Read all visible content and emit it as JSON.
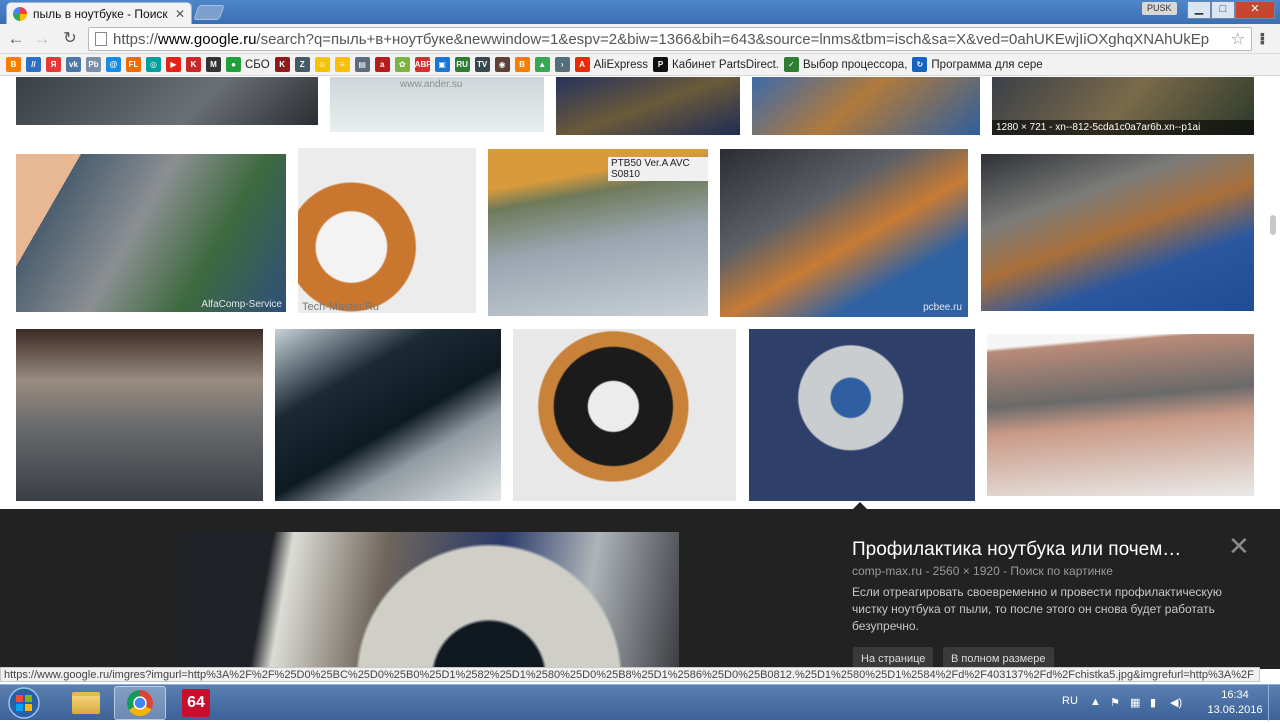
{
  "browser": {
    "tab_title": "пыль в ноутбуке - Поиск",
    "user_badge": "PUSK",
    "url_prefix": "https://",
    "url_host": "www.google.ru",
    "url_rest": "/search?q=пыль+в+ноутбуке&newwindow=1&espv=2&biw=1366&bih=643&source=lnms&tbm=isch&sa=X&ved=0ahUKEwjIiOXghqXNAhUkEp"
  },
  "bookmarks": [
    {
      "label": "",
      "icon": "blogger-icon",
      "color": "#f57d00",
      "glyph": "B"
    },
    {
      "label": "",
      "icon": "stripes-icon",
      "color": "#2d6fc2",
      "glyph": "//"
    },
    {
      "label": "",
      "icon": "yandex-icon",
      "color": "#e53935",
      "glyph": "Я"
    },
    {
      "label": "",
      "icon": "vk-icon",
      "color": "#4a76a8",
      "glyph": "vk"
    },
    {
      "label": "",
      "icon": "rb-icon",
      "color": "#7b8ea8",
      "glyph": "Pb"
    },
    {
      "label": "",
      "icon": "mail-icon",
      "color": "#168de2",
      "glyph": "@"
    },
    {
      "label": "",
      "icon": "fl-icon",
      "color": "#ef6c00",
      "glyph": "FL"
    },
    {
      "label": "",
      "icon": "circle-icon",
      "color": "#00a0a0",
      "glyph": "◎"
    },
    {
      "label": "",
      "icon": "youtube-icon",
      "color": "#e62117",
      "glyph": "▶"
    },
    {
      "label": "",
      "icon": "k-icon",
      "color": "#c62828",
      "glyph": "K"
    },
    {
      "label": "",
      "icon": "m-icon",
      "color": "#333333",
      "glyph": "M"
    },
    {
      "label": "СБО",
      "icon": "sberbank-icon",
      "color": "#21a038",
      "glyph": "●"
    },
    {
      "label": "",
      "icon": "kinopoisk-icon",
      "color": "#8e1b1b",
      "glyph": "K"
    },
    {
      "label": "",
      "icon": "z-icon",
      "color": "#455a64",
      "glyph": "Z"
    },
    {
      "label": "",
      "icon": "smiley-icon",
      "color": "#f5c400",
      "glyph": "☺"
    },
    {
      "label": "",
      "icon": "beeline-icon",
      "color": "#f9c100",
      "glyph": "≡"
    },
    {
      "label": "",
      "icon": "stack-icon",
      "color": "#5d6d7e",
      "glyph": "▤"
    },
    {
      "label": "",
      "icon": "abc-icon",
      "color": "#b71c1c",
      "glyph": "a"
    },
    {
      "label": "",
      "icon": "flower-icon",
      "color": "#7cb342",
      "glyph": "✿"
    },
    {
      "label": "",
      "icon": "adblock-icon",
      "color": "#d32f2f",
      "glyph": "ABP"
    },
    {
      "label": "",
      "icon": "window-icon",
      "color": "#1976d2",
      "glyph": "▣"
    },
    {
      "label": "",
      "icon": "ru-icon",
      "color": "#2e7d32",
      "glyph": "RU"
    },
    {
      "label": "",
      "icon": "tv-icon",
      "color": "#37474f",
      "glyph": "TV"
    },
    {
      "label": "",
      "icon": "lamp-icon",
      "color": "#5d4037",
      "glyph": "◉"
    },
    {
      "label": "",
      "icon": "blogger2-icon",
      "color": "#f57d00",
      "glyph": "B"
    },
    {
      "label": "",
      "icon": "drive-icon",
      "color": "#34a853",
      "glyph": "▲"
    },
    {
      "label": "",
      "icon": "chevron-icon",
      "color": "#546e7a",
      "glyph": "›"
    },
    {
      "label": "AliExpress",
      "icon": "aliexpress-icon",
      "color": "#e62e04",
      "glyph": "A"
    },
    {
      "label": "Кабинет PartsDirect.",
      "icon": "partsdirect-icon",
      "color": "#111111",
      "glyph": "P"
    },
    {
      "label": "Выбор процессора, ",
      "icon": "check-icon",
      "color": "#2e7d32",
      "glyph": "✓"
    },
    {
      "label": "Программа для сере",
      "icon": "sync-icon",
      "color": "#1565c0",
      "glyph": "↻"
    }
  ],
  "results": {
    "hover_caption": "1280 × 721 - xn--812-5cda1c0a7ar6b.xn--p1ai",
    "watermarks": {
      "t1": "www.ander.su",
      "t6": "AlfaComp-Service",
      "t7": "Tech-Master.Ru",
      "t8": "PTB50 Ver.A  AVC S0810",
      "t9": "pcbee.ru"
    }
  },
  "preview": {
    "title": "Профилактика ноутбука или почем…",
    "meta": "comp-max.ru - 2560 × 1920 - Поиск по картинке",
    "description": "Если отреагировать своевременно и провести профилактическую чистку ноутбука от пыли, то после этого он снова будет работать безупречно.",
    "btn_on_page": "На странице",
    "btn_full_size": "В полном размере"
  },
  "status_bar": "https://www.google.ru/imgres?imgurl=http%3A%2F%2F%25D0%25BC%25D0%25B0%25D1%2582%25D1%2580%25D0%25B8%25D1%2586%25D0%25B0812.%25D1%2580%25D1%2584%2Fd%2F403137%2Fd%2Fchistka5.jpg&imgrefurl=http%3A%2F",
  "taskbar": {
    "lang": "RU",
    "time": "16:34",
    "date": "13.06.2016"
  },
  "colors": {
    "titlebar": "#3a6fb3",
    "preview_bg": "#222222",
    "taskbar": "#3c6298"
  }
}
